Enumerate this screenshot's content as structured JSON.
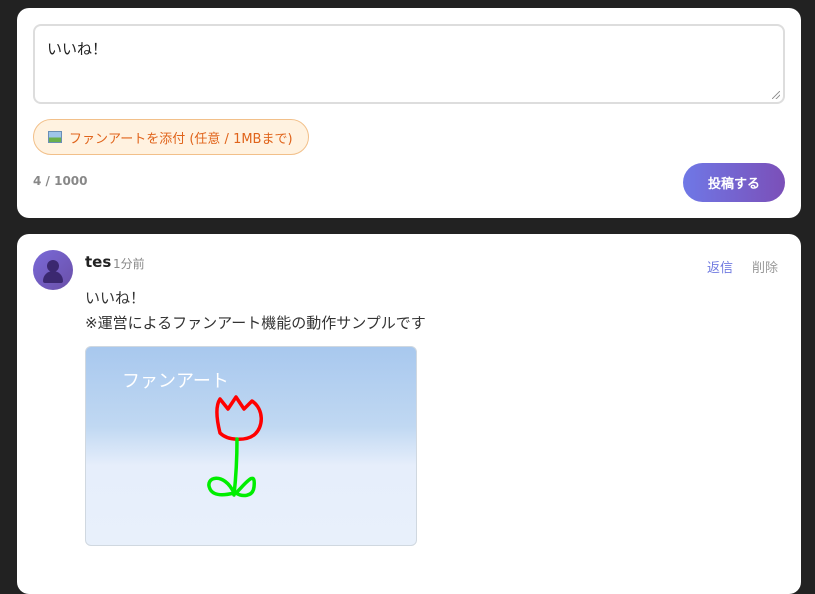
{
  "composer": {
    "comment_value": "いいね！",
    "attach_label": "ファンアートを添付 (任意 / 1MBまで)",
    "counter": "4 / 1000",
    "submit_label": "投稿する"
  },
  "post": {
    "username": "tes",
    "time": "1分前",
    "reply_label": "返信",
    "delete_label": "削除",
    "text_line1": "いいね！",
    "text_line2": "※運営によるファンアート機能の動作サンプルです",
    "fanart_label": "ファンアート"
  },
  "colors": {
    "background": "#222222",
    "accent_gradient_start": "#6f78e6",
    "accent_gradient_end": "#7b4fb8",
    "attach_text": "#e0641b",
    "tulip_flower": "#ff0000",
    "tulip_stem": "#00ee00"
  },
  "icons": {
    "attach": "image-icon",
    "avatar": "user-avatar-icon"
  }
}
